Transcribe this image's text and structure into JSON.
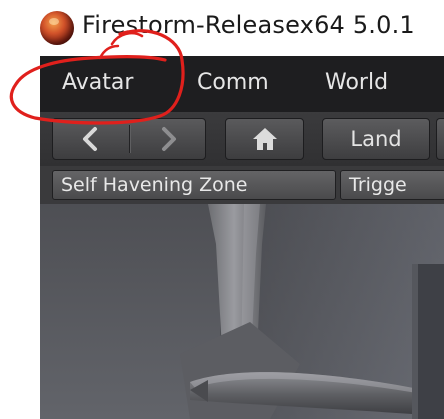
{
  "window": {
    "title": "Firestorm-Releasex64 5.0.1",
    "icon": "firestorm-logo-icon"
  },
  "menubar": {
    "items": [
      {
        "label": "Avatar"
      },
      {
        "label": "Comm"
      },
      {
        "label": "World"
      }
    ]
  },
  "navbar": {
    "back_icon": "chevron-left-icon",
    "forward_icon": "chevron-right-icon",
    "home_icon": "home-icon",
    "land_label": "Land"
  },
  "favorites": {
    "items": [
      {
        "label": "Self Havening Zone"
      },
      {
        "label": "Trigge"
      }
    ]
  },
  "annotation": {
    "color": "#e0201c"
  }
}
